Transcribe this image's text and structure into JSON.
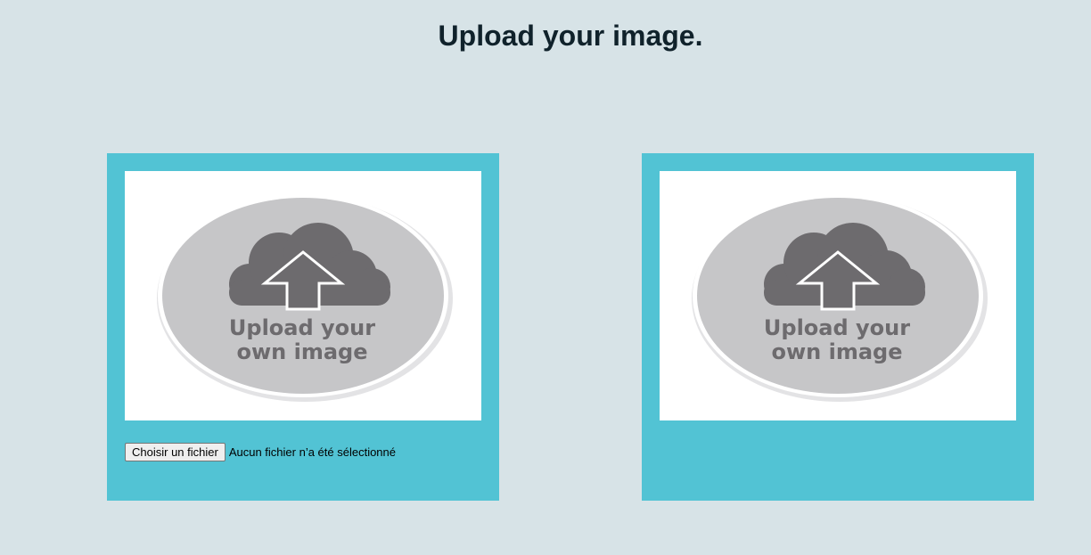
{
  "header": {
    "title": "Upload your image."
  },
  "panels": [
    {
      "image_text_line1": "Upload your",
      "image_text_line2": "own image",
      "icon": "cloud-upload-icon",
      "file_button_label": "Choisir un fichier",
      "file_status": "Aucun fichier n’a été sélectionné"
    },
    {
      "image_text_line1": "Upload your",
      "image_text_line2": "own image",
      "icon": "cloud-upload-icon"
    }
  ],
  "colors": {
    "background": "#d7e3e7",
    "panel": "#52c3d4",
    "placeholder_oval": "#c6c6c8",
    "icon_dark": "#6d6b6e",
    "title": "#10222b"
  }
}
